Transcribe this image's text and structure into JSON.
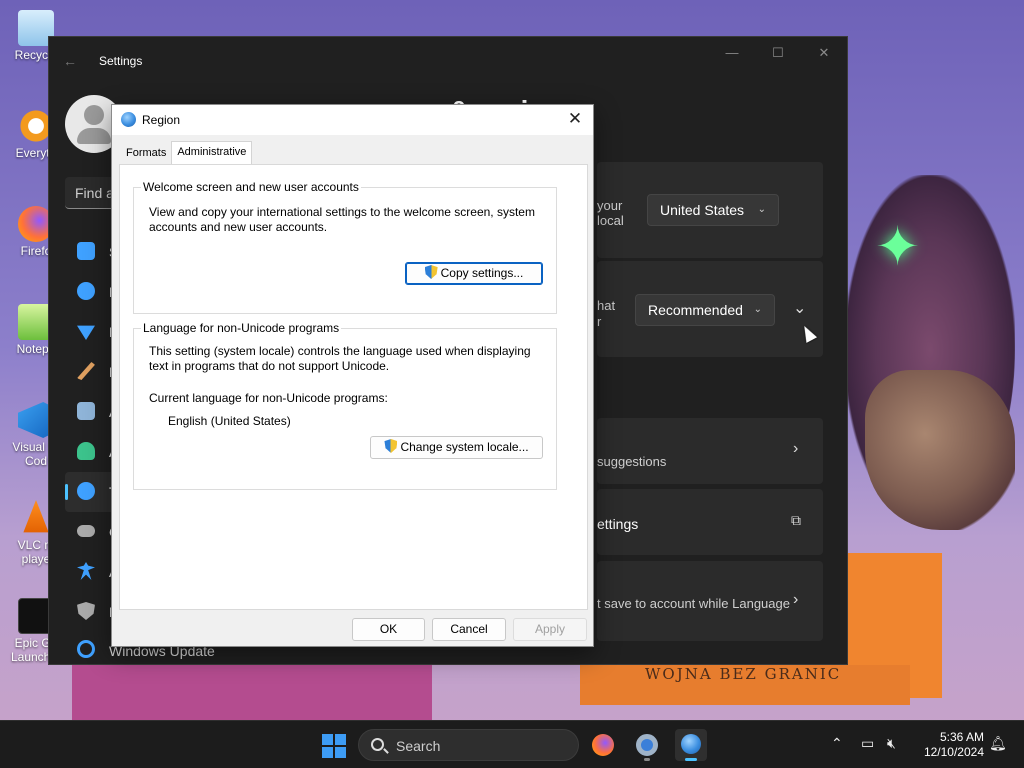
{
  "desktop": {
    "icons": [
      {
        "label": "Recycle"
      },
      {
        "label": "Everyth"
      },
      {
        "label": "Firefo"
      },
      {
        "label": "Notepa"
      },
      {
        "label": "Visual St Cod"
      },
      {
        "label": "VLC m playe"
      },
      {
        "label": "Epic Ga Launcher"
      }
    ],
    "banner_text": "WOJNA BEZ GRANIC"
  },
  "settings": {
    "title": "Settings",
    "heading": "Language & region",
    "heading_visible": "& region",
    "search_placeholder": "Find a",
    "nav": [
      {
        "label": "S",
        "icon": "system-icon",
        "color": "#3fa1ff"
      },
      {
        "label": "B",
        "icon": "bluetooth-icon",
        "color": "#3fa1ff"
      },
      {
        "label": "N",
        "icon": "network-icon",
        "color": "#3fa1ff"
      },
      {
        "label": "P",
        "icon": "personalization-icon",
        "color": "#e0a060"
      },
      {
        "label": "A",
        "icon": "apps-icon",
        "color": "#8fb4d8"
      },
      {
        "label": "A",
        "icon": "accounts-icon",
        "color": "#3cc38c"
      },
      {
        "label": "T",
        "icon": "time-language-icon",
        "color": "#3fa1ff"
      },
      {
        "label": "G",
        "icon": "gaming-icon",
        "color": "#aaaaaa"
      },
      {
        "label": "A",
        "icon": "accessibility-icon",
        "color": "#3fa1ff"
      },
      {
        "label": "P",
        "icon": "privacy-icon",
        "color": "#aaaaaa"
      }
    ],
    "windows_update": "Windows Update",
    "country_card": {
      "text1": "your",
      "text2": "local",
      "value": "United States"
    },
    "format_card": {
      "text1": "hat",
      "text2": "r",
      "value": "Recommended"
    },
    "suggestions_card": {
      "text": "suggestions"
    },
    "settings_card": {
      "text": "ettings"
    },
    "save_card": {
      "text": "t save to account while Language"
    }
  },
  "region_dialog": {
    "title": "Region",
    "tabs": [
      "Formats",
      "Administrative"
    ],
    "selected_tab": "Administrative",
    "welcome_group": {
      "label": "Welcome screen and new user accounts",
      "desc_line1": "View and copy your international settings to the welcome screen, system",
      "desc_line2": "accounts and new user accounts.",
      "button": "Copy settings..."
    },
    "unicode_group": {
      "label": "Language for non-Unicode programs",
      "desc_line1": "This setting (system locale) controls the language used when displaying",
      "desc_line2": "text in programs that do not support Unicode.",
      "current_label": "Current language for non-Unicode programs:",
      "current_value": "English (United States)",
      "button": "Change system locale..."
    },
    "buttons": {
      "ok": "OK",
      "cancel": "Cancel",
      "apply": "Apply"
    }
  },
  "taskbar": {
    "search_label": "Search",
    "time": "5:36 AM",
    "date": "12/10/2024"
  }
}
